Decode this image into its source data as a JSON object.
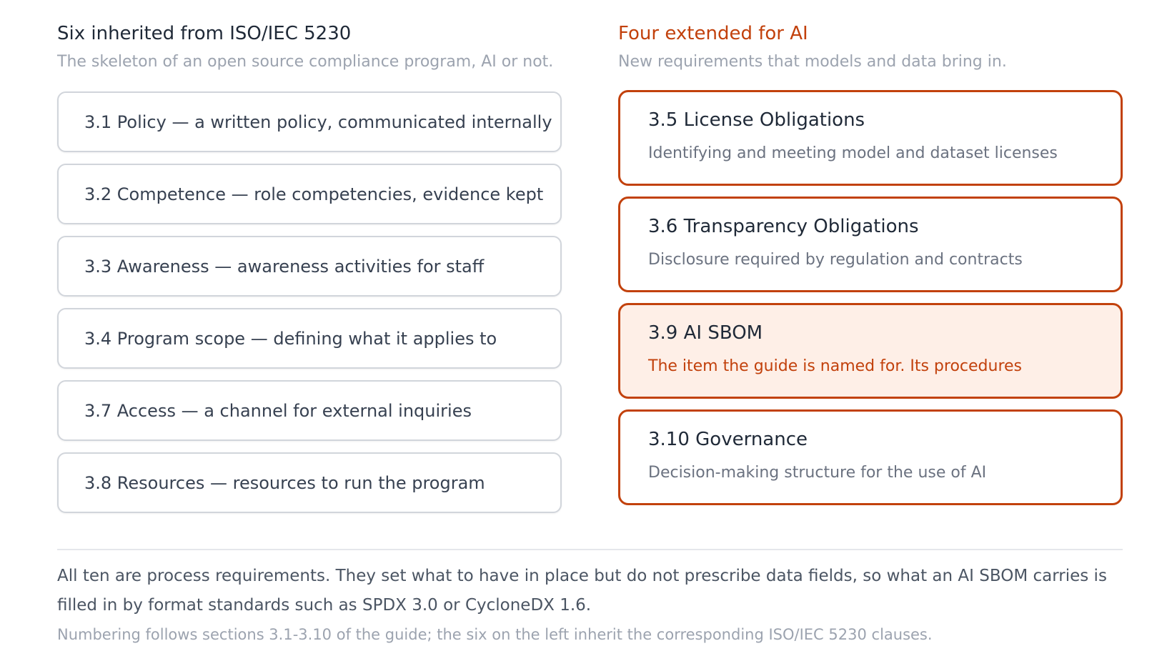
{
  "left": {
    "title": "Six inherited from ISO/IEC 5230",
    "subtitle": "The skeleton of an open source compliance program, AI or not.",
    "items": [
      "3.1 Policy — a written policy, communicated internally",
      "3.2 Competence — role competencies, evidence kept",
      "3.3 Awareness — awareness activities for staff",
      "3.4 Program scope — defining what it applies to",
      "3.7 Access — a channel for external inquiries",
      "3.8 Resources — resources to run the program"
    ]
  },
  "right": {
    "title": "Four extended for AI",
    "subtitle": "New requirements that models and data bring in.",
    "items": [
      {
        "title": "3.5 License Obligations",
        "desc": "Identifying and meeting model and dataset licenses"
      },
      {
        "title": "3.6 Transparency Obligations",
        "desc": "Disclosure required by regulation and contracts"
      },
      {
        "title": "3.9 AI SBOM",
        "desc": "The item the guide is named for. Its procedures"
      },
      {
        "title": "3.10 Governance",
        "desc": "Decision-making structure for the use of AI"
      }
    ]
  },
  "footer": {
    "main": "All ten are process requirements. They set what to have in place but do not prescribe data fields, so what an AI SBOM carries is filled in by format standards such as SPDX 3.0 or CycloneDX 1.6.",
    "note": "Numbering follows sections 3.1-3.10 of the guide; the six on the left inherit the corresponding ISO/IEC 5230 clauses."
  },
  "colors": {
    "accent": "#c2410c",
    "highlight_bg": "#feefe7",
    "card_border": "#d1d5db"
  }
}
